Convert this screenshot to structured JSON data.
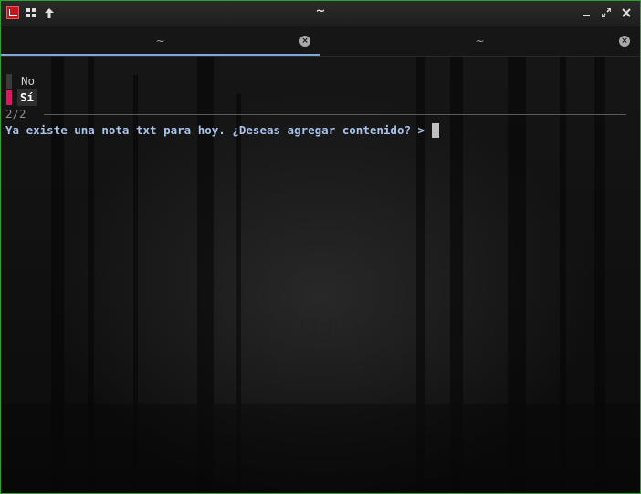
{
  "window": {
    "title": "~",
    "border_color": "#2aa52a",
    "icons": [
      "terminal-app-icon",
      "grid-icon",
      "arrow-up-icon"
    ],
    "controls": [
      "minimize-icon",
      "restore-icon",
      "close-icon"
    ]
  },
  "tabs": [
    {
      "label": "~",
      "active": true
    },
    {
      "label": "~",
      "active": false
    }
  ],
  "terminal": {
    "options": [
      {
        "label": "No",
        "selected": false
      },
      {
        "label": "Sí",
        "selected": true
      }
    ],
    "counter": "2/2",
    "prompt": "Ya existe una nota txt para hoy. ¿Deseas agregar contenido? >",
    "selection_color": "#d81b60",
    "prompt_color": "#a9c3ea"
  }
}
